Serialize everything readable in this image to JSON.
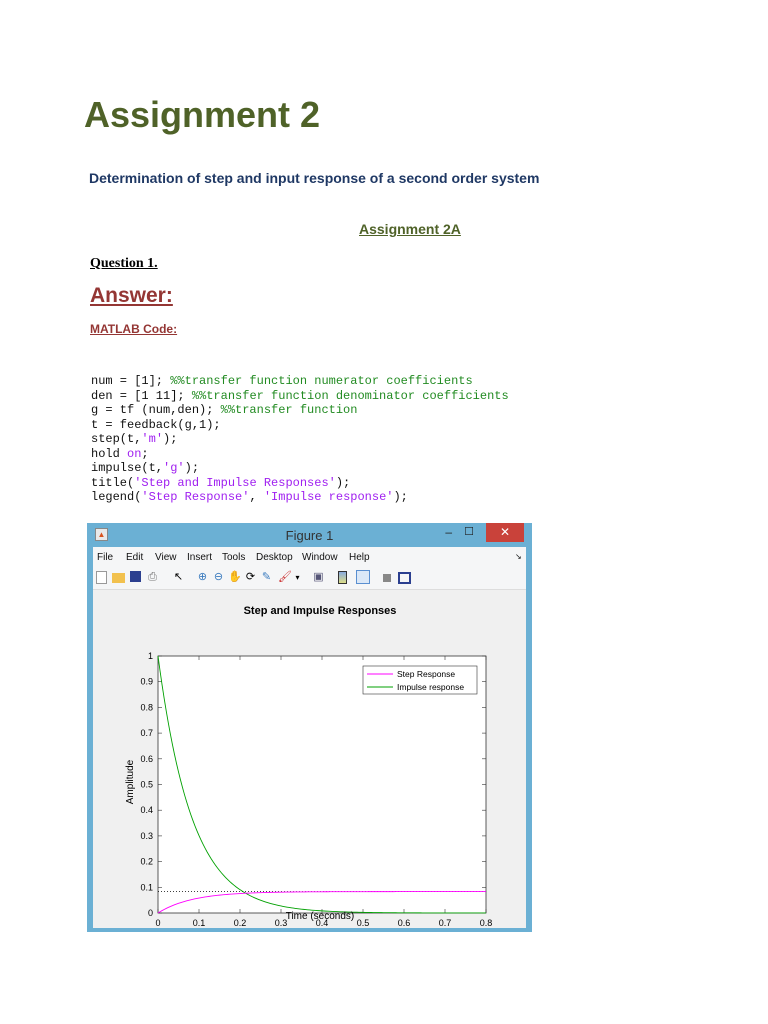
{
  "doc": {
    "title": "Assignment 2",
    "subtitle": "Determination of step and input response of a second order system",
    "section": "Assignment 2A",
    "question": "Question 1.",
    "answer": "Answer:",
    "code_label": "MATLAB Code:"
  },
  "code": [
    {
      "code": "num = [1]; ",
      "comment": "%%transfer function numerator coefficients"
    },
    {
      "code": "den = [1 11]; ",
      "comment": "%%transfer function denominator coefficients"
    },
    {
      "code": "g = tf (num,den); ",
      "comment": "%%transfer function"
    },
    {
      "code": "t = feedback(g,1);"
    },
    {
      "code": "step(t,",
      "str": "'m'",
      "tail": ");"
    },
    {
      "code": "hold ",
      "str": "on",
      "tail": ";"
    },
    {
      "code": "impulse(t,",
      "str": "'g'",
      "tail": ");"
    },
    {
      "code": "title(",
      "str": "'Step and Impulse Responses'",
      "tail": ");"
    },
    {
      "code": "legend(",
      "str": "'Step Response'",
      "mid": ", ",
      "str2": "'Impulse response'",
      "tail": ");"
    }
  ],
  "figure": {
    "window_title": "Figure 1",
    "menu": [
      "File",
      "Edit",
      "View",
      "Insert",
      "Tools",
      "Desktop",
      "Window",
      "Help"
    ],
    "close": "✕",
    "minimize": "–",
    "maximize": "☐"
  },
  "colors": {
    "step": "#ff00ff",
    "impulse": "#00a000"
  },
  "chart_data": {
    "type": "line",
    "title": "Step and Impulse Responses",
    "xlabel": "Time (seconds)",
    "ylabel": "Amplitude",
    "xlim": [
      0,
      0.8
    ],
    "ylim": [
      0,
      1
    ],
    "xticks": [
      "0",
      "0.1",
      "0.2",
      "0.3",
      "0.4",
      "0.5",
      "0.6",
      "0.7",
      "0.8"
    ],
    "yticks": [
      "0",
      "0.1",
      "0.2",
      "0.3",
      "0.4",
      "0.5",
      "0.6",
      "0.7",
      "0.8",
      "0.9",
      "1"
    ],
    "grid": false,
    "legend_position": "top-right",
    "x": [
      0,
      0.05,
      0.1,
      0.15,
      0.2,
      0.25,
      0.3,
      0.35,
      0.4,
      0.45,
      0.5,
      0.55,
      0.6,
      0.65,
      0.7,
      0.75,
      0.8
    ],
    "series": [
      {
        "name": "Step Response",
        "values": [
          0,
          0.0376,
          0.0582,
          0.0696,
          0.0758,
          0.0792,
          0.0811,
          0.0821,
          0.0827,
          0.083,
          0.0831,
          0.0832,
          0.0833,
          0.0833,
          0.0833,
          0.0833,
          0.0833
        ],
        "steady_state": 0.0833
      },
      {
        "name": "Impulse response",
        "values": [
          1,
          0.5488,
          0.3012,
          0.1653,
          0.0907,
          0.0498,
          0.0273,
          0.015,
          0.0082,
          0.0045,
          0.0025,
          0.0014,
          0.0007,
          0.0004,
          0.0002,
          0.0001,
          0.0001
        ]
      }
    ]
  }
}
